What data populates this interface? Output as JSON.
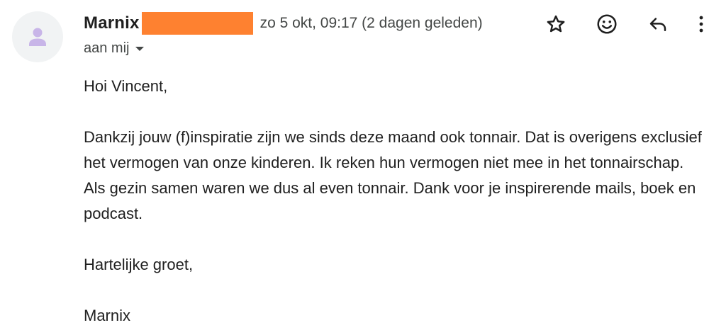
{
  "message": {
    "sender": {
      "name": "Marnix",
      "avatar_icon": "person-icon"
    },
    "timestamp": "zo 5 okt, 09:17 (2 dagen geleden)",
    "recipient": "aan mij",
    "actions": [
      {
        "name": "star",
        "icon": "star-outline-icon"
      },
      {
        "name": "react",
        "icon": "emoji-smile-icon"
      },
      {
        "name": "reply",
        "icon": "reply-icon"
      },
      {
        "name": "more",
        "icon": "more-vert-icon"
      }
    ],
    "body": {
      "greeting": "Hoi Vincent,",
      "paragraph": "Dankzij jouw (f)inspiratie zijn we sinds deze maand ook tonnair. Dat is overigens exclusief het vermogen van onze kinderen. Ik reken hun vermogen niet mee in het tonnairschap. Als gezin samen waren we dus al even tonnair. Dank voor je inspirerende mails, boek en podcast.",
      "closing": "Hartelijke groet,",
      "signature": "Marnix"
    }
  },
  "colors": {
    "redaction": "#fe8130",
    "avatar_bg": "#f1f3f4",
    "avatar_icon": "#c8b5e8",
    "text": "#1f1f1f",
    "secondary_text": "#444746"
  }
}
